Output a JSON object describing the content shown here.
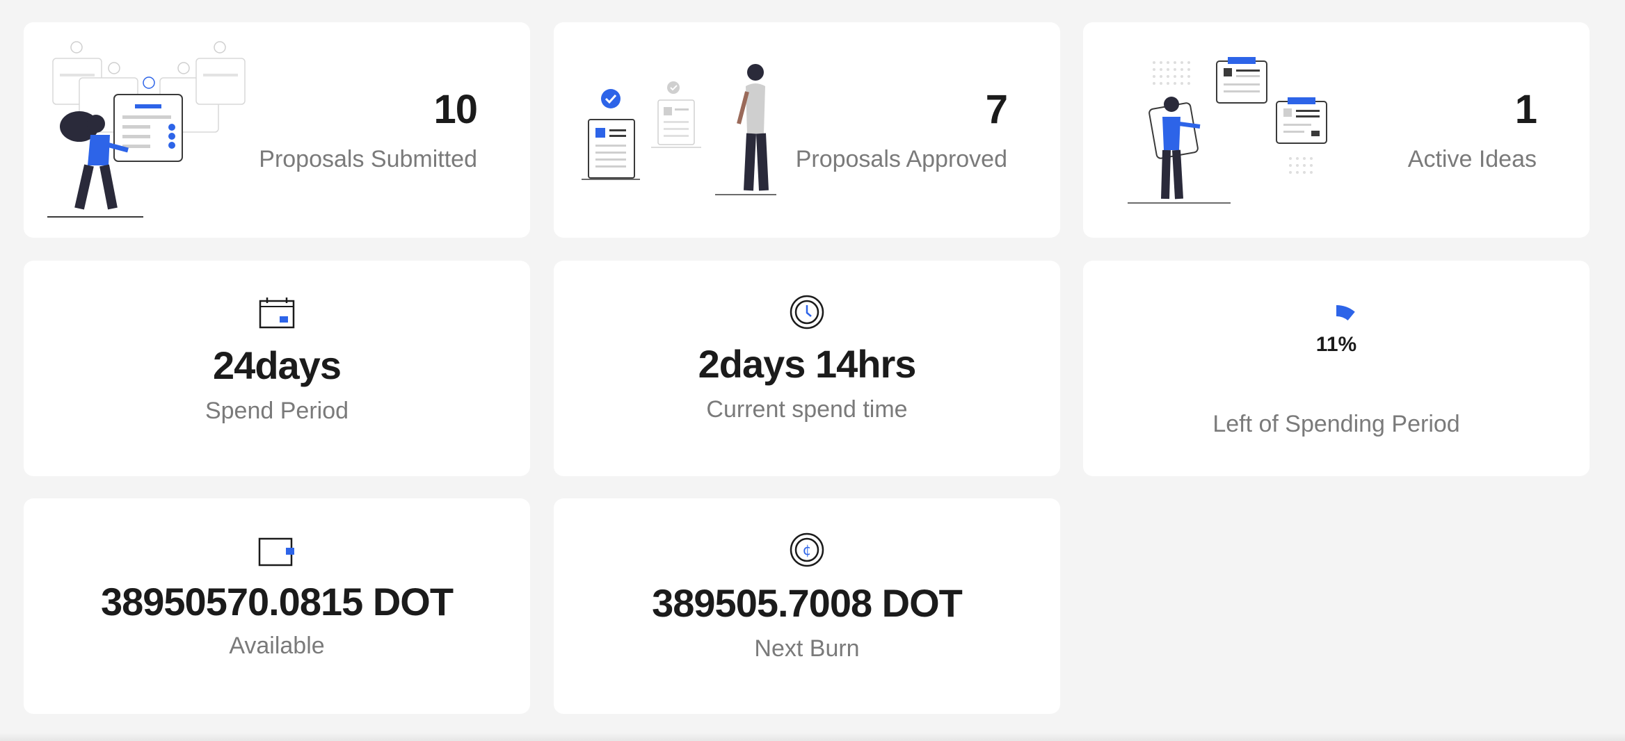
{
  "stats": {
    "proposals_submitted": {
      "value": "10",
      "label": "Proposals Submitted"
    },
    "proposals_approved": {
      "value": "7",
      "label": "Proposals Approved"
    },
    "active_ideas": {
      "value": "1",
      "label": "Active Ideas"
    }
  },
  "spend_period": {
    "value": "24days",
    "label": "Spend Period",
    "icon": "calendar-icon"
  },
  "current_spend_time": {
    "value": "2days 14hrs",
    "label": "Current spend time",
    "icon": "clock-icon"
  },
  "spending_left": {
    "percent_text": "11%",
    "percent": 11,
    "label": "Left of Spending Period",
    "icon": "progress-arc-icon"
  },
  "available": {
    "value": "38950570.0815 DOT",
    "label": "Available",
    "icon": "wallet-icon"
  },
  "next_burn": {
    "value": "389505.7008 DOT",
    "label": "Next Burn",
    "icon": "coin-icon"
  },
  "colors": {
    "accent": "#2d64e8",
    "background": "#f4f4f4",
    "card": "#ffffff",
    "text_primary": "#1b1b1b",
    "text_secondary": "#7a7a7a"
  }
}
